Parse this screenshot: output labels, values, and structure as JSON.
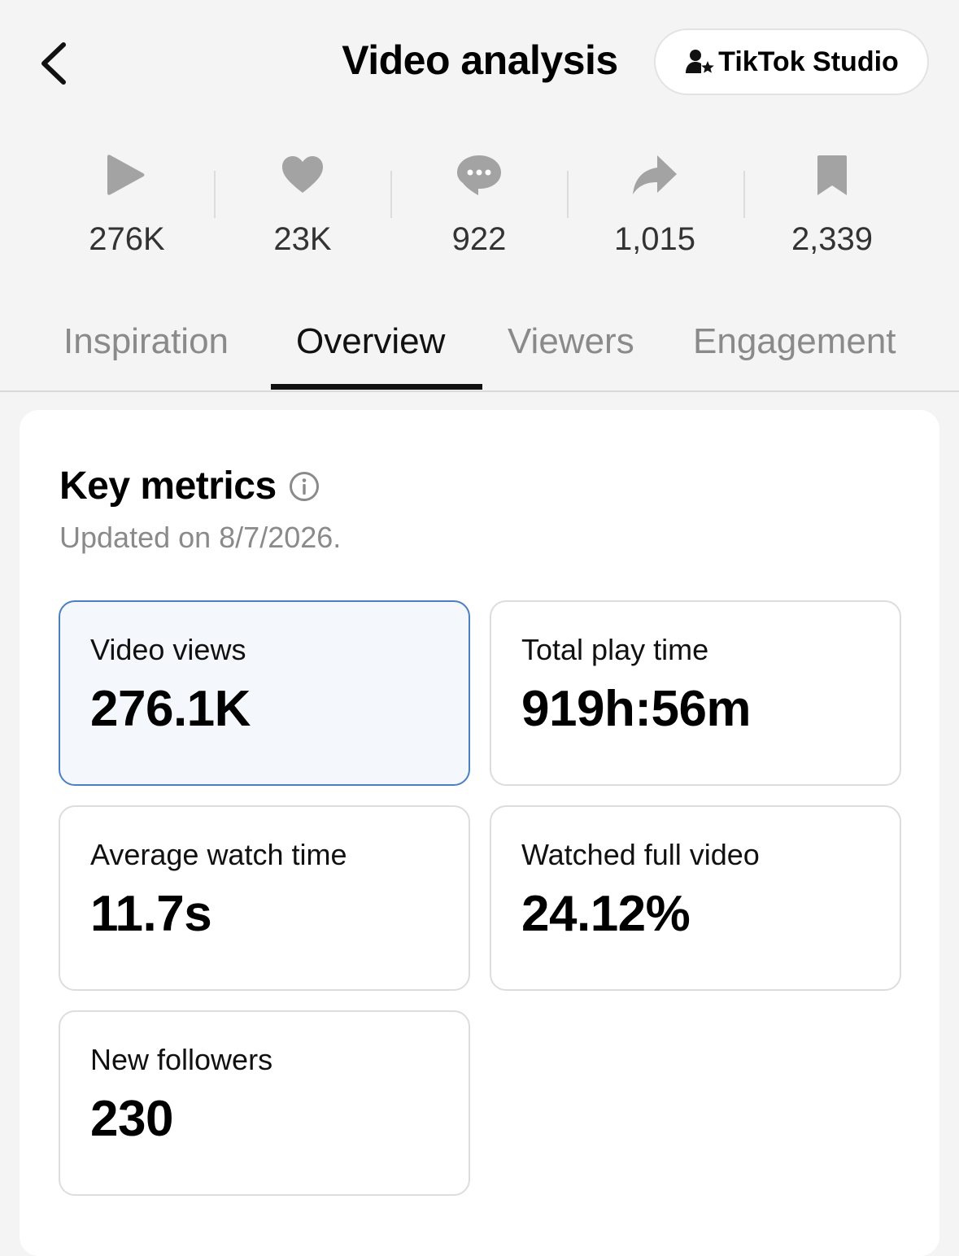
{
  "header": {
    "title": "Video analysis",
    "studio_button_label": "TikTok Studio"
  },
  "stats": [
    {
      "icon": "play-icon",
      "value": "276K"
    },
    {
      "icon": "heart-icon",
      "value": "23K"
    },
    {
      "icon": "comment-icon",
      "value": "922"
    },
    {
      "icon": "share-icon",
      "value": "1,015"
    },
    {
      "icon": "bookmark-icon",
      "value": "2,339"
    }
  ],
  "tabs": [
    {
      "label": "Inspiration",
      "active": false
    },
    {
      "label": "Overview",
      "active": true
    },
    {
      "label": "Viewers",
      "active": false
    },
    {
      "label": "Engagement",
      "active": false
    }
  ],
  "key_metrics": {
    "title": "Key metrics",
    "updated": "Updated on 8/7/2026.",
    "metrics": [
      {
        "label": "Video views",
        "value": "276.1K",
        "selected": true
      },
      {
        "label": "Total play time",
        "value": "919h:56m",
        "selected": false
      },
      {
        "label": "Average watch time",
        "value": "11.7s",
        "selected": false
      },
      {
        "label": "Watched full video",
        "value": "24.12%",
        "selected": false
      },
      {
        "label": "New followers",
        "value": "230",
        "selected": false
      }
    ]
  },
  "colors": {
    "background": "#f4f4f4",
    "icon_gray": "#a3a3a3",
    "selected_border": "#4a7fc1",
    "selected_fill": "#f4f8fd"
  }
}
